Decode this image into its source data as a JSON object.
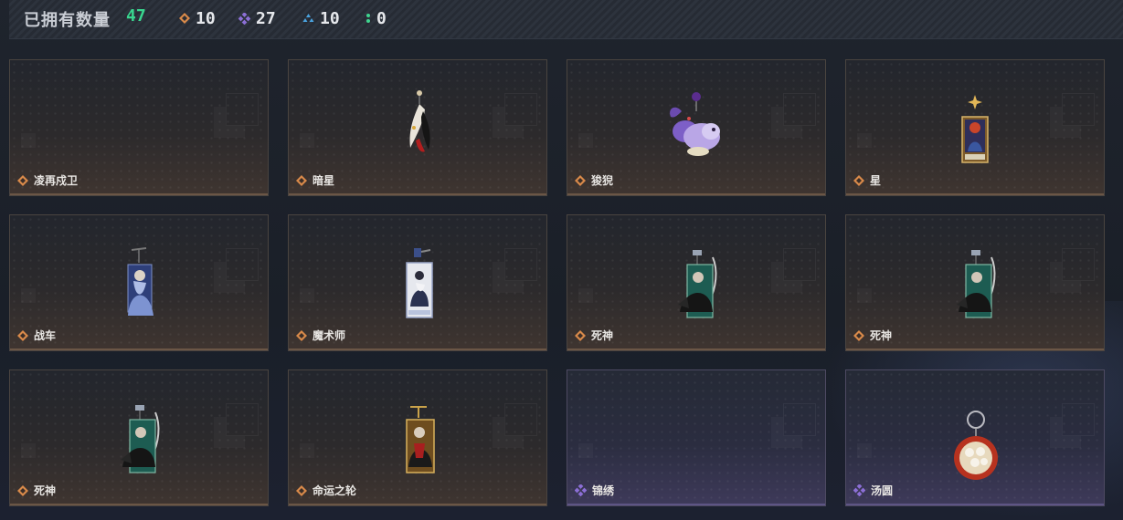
{
  "header": {
    "owned_label": "已拥有数量",
    "owned_count": "47",
    "stats": [
      {
        "icon": "orange-diamond-icon",
        "color": "#d98a4a",
        "value": "10"
      },
      {
        "icon": "purple-diamond-icon",
        "color": "#8c6fd6",
        "value": "27"
      },
      {
        "icon": "blue-triangle-icon",
        "color": "#4aa3e0",
        "value": "10"
      },
      {
        "icon": "green-dots-icon",
        "color": "#3fd68f",
        "value": "0"
      }
    ]
  },
  "items": [
    {
      "name": "凌再戍卫",
      "rarity": "orange",
      "art": "empty"
    },
    {
      "name": "暗星",
      "rarity": "orange",
      "art": "feather-charm"
    },
    {
      "name": "狻猊",
      "rarity": "orange",
      "art": "lion-charm"
    },
    {
      "name": "星",
      "rarity": "orange",
      "art": "star-card"
    },
    {
      "name": "战车",
      "rarity": "orange",
      "art": "chariot-card"
    },
    {
      "name": "魔术师",
      "rarity": "orange",
      "art": "magician-card"
    },
    {
      "name": "死神",
      "rarity": "orange",
      "art": "death-card"
    },
    {
      "name": "死神",
      "rarity": "orange",
      "art": "death-card"
    },
    {
      "name": "死神",
      "rarity": "orange",
      "art": "death-card"
    },
    {
      "name": "命运之轮",
      "rarity": "orange",
      "art": "wheel-card"
    },
    {
      "name": "锦绣",
      "rarity": "purple",
      "art": "empty"
    },
    {
      "name": "汤圆",
      "rarity": "purple",
      "art": "dumpling-charm"
    }
  ]
}
